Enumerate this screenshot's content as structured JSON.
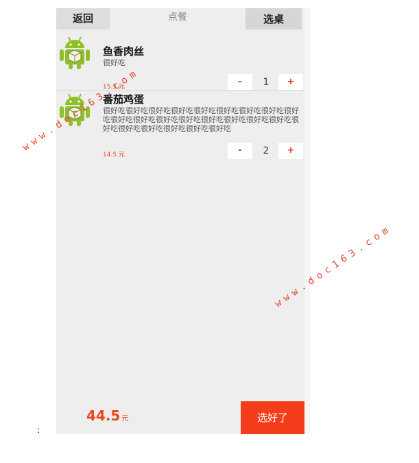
{
  "header": {
    "back_label": "返回",
    "title": "点餐",
    "select_table_label": "选桌"
  },
  "items": [
    {
      "name": "鱼香肉丝",
      "description": "很好吃",
      "price": "15.5",
      "unit": "元",
      "quantity": "1",
      "minus_label": "-",
      "plus_label": "+"
    },
    {
      "name": "番茄鸡蛋",
      "description": "很好吃很好吃很好吃很好吃很好吃很好吃很好吃很好吃很好吃很好吃很好吃很好吃很好吃很好吃很好吃很好吃很好吃很好吃很好吃很好吃很好吃很好吃很好吃",
      "price": "14.5",
      "unit": "元",
      "quantity": "2",
      "minus_label": "-",
      "plus_label": "+"
    }
  ],
  "footer": {
    "total": "44.5",
    "total_unit": "元",
    "done_label": "选好了"
  },
  "watermark": "www.doc163.com",
  "colors": {
    "accent": "#f43d1a",
    "price": "#e8461c",
    "background": "#eeeeee",
    "android_green": "#8fbf2a"
  },
  "icons": [
    "android-robot-icon"
  ]
}
